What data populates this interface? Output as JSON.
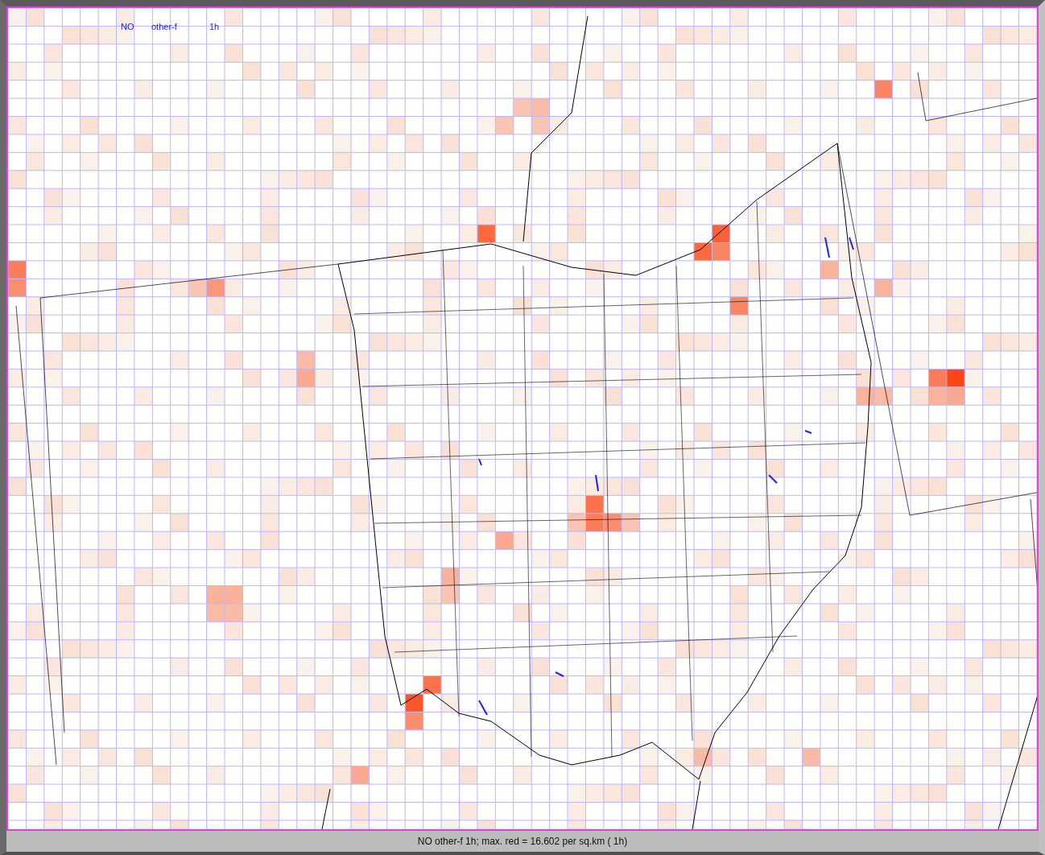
{
  "map": {
    "labels": [
      "NO",
      "other-f",
      "1h"
    ]
  },
  "status_bar": "NO other-f 1h; max. red = 16.602 per sq.km ( 1h)"
}
